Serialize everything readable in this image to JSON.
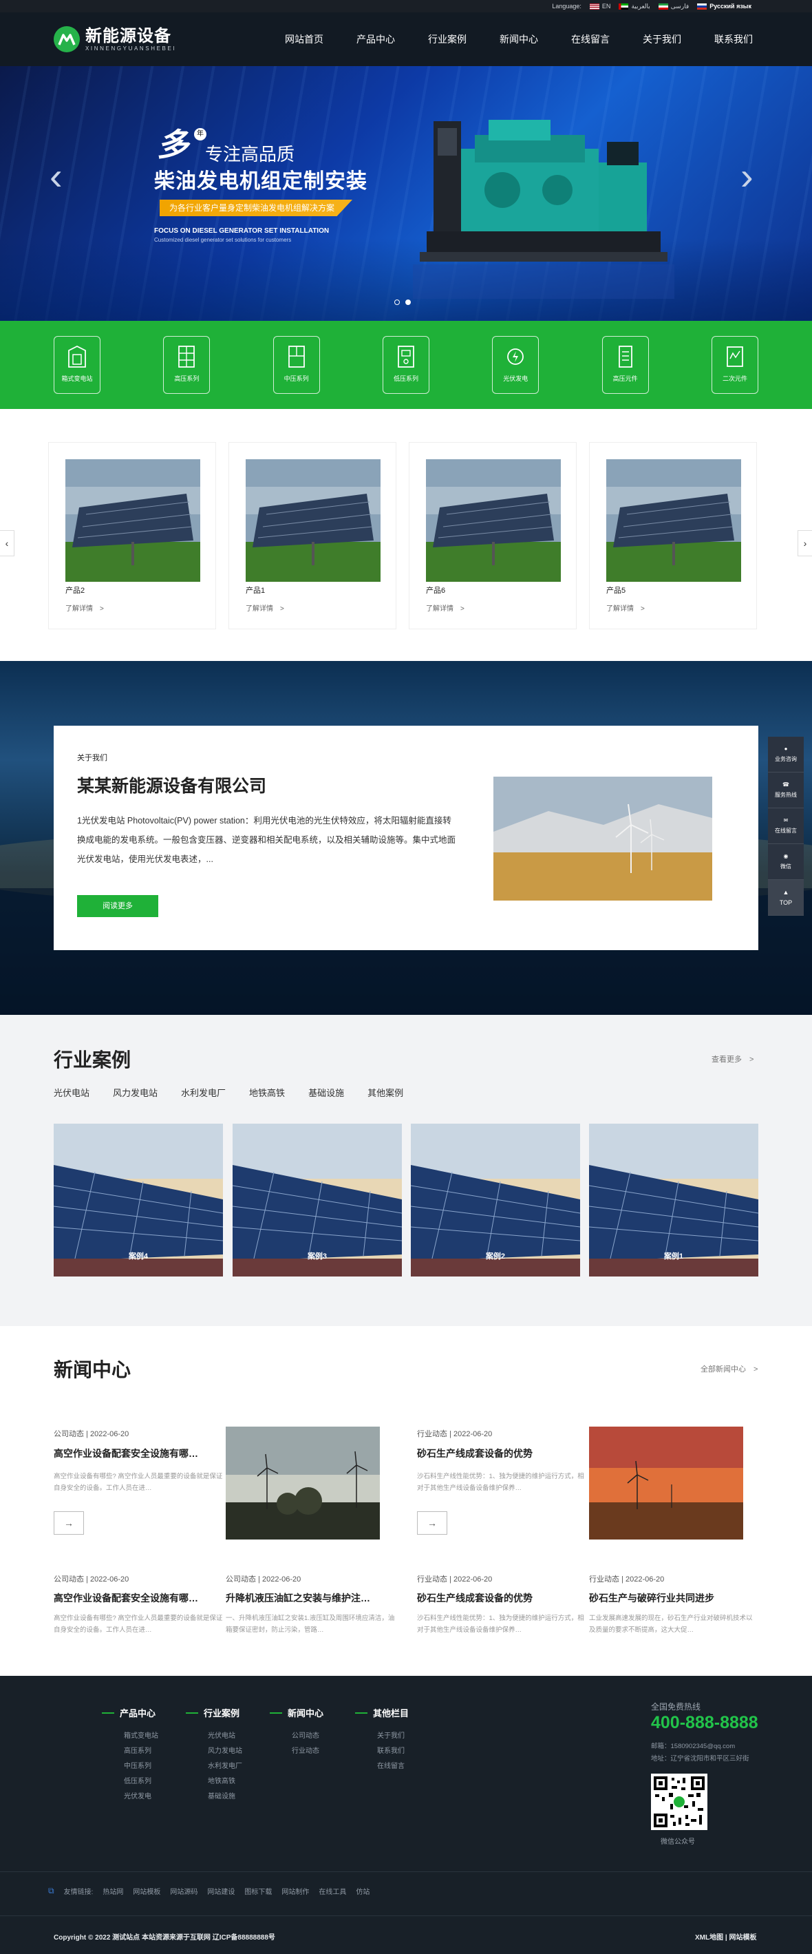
{
  "langbar": {
    "label": "Language:",
    "langs": [
      "EN",
      "بالعربية",
      "فارسی",
      "Русский язык"
    ]
  },
  "header": {
    "logo_cn": "新能源设备",
    "logo_en": "XINNENGYUANSHEBEI",
    "nav": [
      "网站首页",
      "产品中心",
      "行业案例",
      "新闻中心",
      "在线留言",
      "关于我们",
      "联系我们"
    ]
  },
  "banner": {
    "duo": "多",
    "nian": "年",
    "line1": "专注高品质",
    "line2": "柴油发电机组定制安装",
    "tag": "为各行业客户量身定制柴油发电机组解决方案",
    "en1": "FOCUS ON DIESEL GENERATOR SET INSTALLATION",
    "en2": "Customized diesel generator set solutions for customers"
  },
  "categories": [
    "箱式变电站",
    "高压系列",
    "中压系列",
    "低压系列",
    "光伏发电",
    "高压元件",
    "二次元件"
  ],
  "products": [
    {
      "name": "产品2",
      "more": "了解详情　>"
    },
    {
      "name": "产品1",
      "more": "了解详情　>"
    },
    {
      "name": "产品6",
      "more": "了解详情　>"
    },
    {
      "name": "产品5",
      "more": "了解详情　>"
    }
  ],
  "about": {
    "sub": "关于我们",
    "title": "某某新能源设备有限公司",
    "text": "1光伏发电站 Photovoltaic(PV) power station：利用光伏电池的光生伏特效应，将太阳辐射能直接转换成电能的发电系统。一般包含变压器、逆变器和相关配电系统，以及相关辅助设施等。集中式地面光伏发电站，使用光伏发电表述，...",
    "button": "阅读更多"
  },
  "float_bar": [
    "业务咨询",
    "服务热线",
    "在线留言",
    "微信",
    "TOP"
  ],
  "cases": {
    "title": "行业案例",
    "more": "查看更多　>",
    "tabs": [
      "光伏电站",
      "风力发电站",
      "水利发电厂",
      "地铁高铁",
      "基础设施",
      "其他案例"
    ],
    "items": [
      "案例4",
      "案例3",
      "案例2",
      "案例1"
    ]
  },
  "news": {
    "title": "新闻中心",
    "more": "全部新闻中心　>",
    "featured": [
      {
        "meta": "公司动态 | 2022-06-20",
        "title": "高空作业设备配套安全设施有哪…",
        "desc": "高空作业设备有哪些? 高空作业人员最重要的设备就是保证自身安全的设备。工作人员在进…"
      },
      {
        "meta": "行业动态 | 2022-06-20",
        "title": "砂石生产线成套设备的优势",
        "desc": "沙石料生产线性能优势：1、独为便捷的维护运行方式，相对于其他生产线设备设备维护保养…"
      }
    ],
    "items": [
      {
        "meta": "公司动态 | 2022-06-20",
        "title": "高空作业设备配套安全设施有哪…",
        "desc": "高空作业设备有哪些? 高空作业人员最重要的设备就是保证自身安全的设备。工作人员在进…"
      },
      {
        "meta": "公司动态 | 2022-06-20",
        "title": "升降机液压油缸之安装与维护注…",
        "desc": "一、升降机液压油缸之安装1.液压缸及周围环境应清洁，油箱要保证密封，防止污染，管路…"
      },
      {
        "meta": "行业动态 | 2022-06-20",
        "title": "砂石生产线成套设备的优势",
        "desc": "沙石料生产线性能优势：1、独为便捷的维护运行方式，相对于其他生产线设备设备维护保养…"
      },
      {
        "meta": "行业动态 | 2022-06-20",
        "title": "砂石生产与破碎行业共同进步",
        "desc": "工业发展高速发展的现在，砂石生产行业对破碎机技术以及质量的要求不断提高，这大大促…"
      }
    ]
  },
  "footer": {
    "cols": [
      {
        "title": "产品中心",
        "items": [
          "箱式变电站",
          "高压系列",
          "中压系列",
          "低压系列",
          "光伏发电"
        ]
      },
      {
        "title": "行业案例",
        "items": [
          "光伏电站",
          "风力发电站",
          "水利发电厂",
          "地铁高铁",
          "基础设施"
        ]
      },
      {
        "title": "新闻中心",
        "items": [
          "公司动态",
          "行业动态"
        ]
      },
      {
        "title": "其他栏目",
        "items": [
          "关于我们",
          "联系我们",
          "在线留言"
        ]
      }
    ],
    "hotline_label": "全国免费热线",
    "hotline": "400-888-8888",
    "email": "邮箱：1580902345@qq.com",
    "address": "地址：辽宁省沈阳市和平区三好街",
    "qr_label": "微信公众号",
    "links_label": "友情链接:",
    "links": [
      "热站网",
      "网站模板",
      "网站源码",
      "网站建设",
      "图标下载",
      "网站制作",
      "在线工具",
      "仿站"
    ],
    "copyright": "Copyright © 2022 测试站点 本站资源来源于互联网 辽ICP备88888888号",
    "footer_right": "XML地图 | 网站模板"
  },
  "colors": {
    "accent_green": "#1fb138",
    "header_bg": "#121a23",
    "footer_bg": "#182028"
  }
}
